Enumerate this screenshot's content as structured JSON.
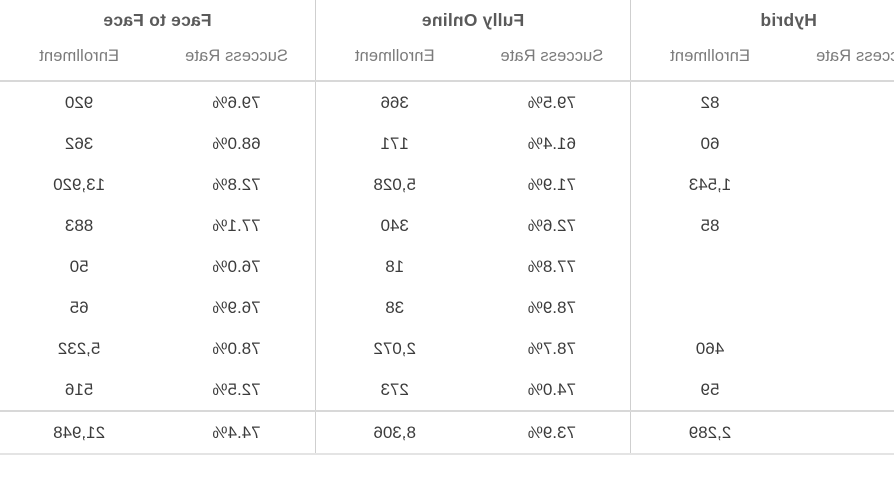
{
  "table": {
    "groups": [
      {
        "id": "hybrid",
        "label": "Hybrid"
      },
      {
        "id": "fully-online",
        "label": "Fully Online"
      },
      {
        "id": "face-to-face",
        "label": "Face to Face"
      }
    ],
    "subheaders": {
      "enrollment": "Enrollment",
      "success_rate": "Success Rate"
    },
    "columns": [
      "Hybrid Success Rate",
      "Hybrid Enrollment",
      "Fully Online Success Rate",
      "Fully Online Enrollment",
      "Face to Face Success Rate",
      "Face to Face Enrollment"
    ],
    "rows": [
      {
        "hybrid_success_rate": "",
        "hybrid_enrollment": "82",
        "online_success_rate": "79.5%",
        "online_enrollment": "366",
        "f2f_success_rate": "79.6%",
        "f2f_enrollment": "920",
        "is_total": false
      },
      {
        "hybrid_success_rate": "",
        "hybrid_enrollment": "60",
        "online_success_rate": "61.4%",
        "online_enrollment": "171",
        "f2f_success_rate": "68.0%",
        "f2f_enrollment": "362",
        "is_total": false
      },
      {
        "hybrid_success_rate": "",
        "hybrid_enrollment": "1,543",
        "online_success_rate": "71.9%",
        "online_enrollment": "5,028",
        "f2f_success_rate": "72.8%",
        "f2f_enrollment": "13,920",
        "is_total": false
      },
      {
        "hybrid_success_rate": "",
        "hybrid_enrollment": "85",
        "online_success_rate": "72.6%",
        "online_enrollment": "340",
        "f2f_success_rate": "77.1%",
        "f2f_enrollment": "883",
        "is_total": false
      },
      {
        "hybrid_success_rate": "",
        "hybrid_enrollment": "",
        "online_success_rate": "77.8%",
        "online_enrollment": "18",
        "f2f_success_rate": "76.0%",
        "f2f_enrollment": "50",
        "is_total": false
      },
      {
        "hybrid_success_rate": "",
        "hybrid_enrollment": "",
        "online_success_rate": "78.9%",
        "online_enrollment": "38",
        "f2f_success_rate": "76.9%",
        "f2f_enrollment": "65",
        "is_total": false
      },
      {
        "hybrid_success_rate": "",
        "hybrid_enrollment": "460",
        "online_success_rate": "78.7%",
        "online_enrollment": "2,072",
        "f2f_success_rate": "78.0%",
        "f2f_enrollment": "5,232",
        "is_total": false
      },
      {
        "hybrid_success_rate": "",
        "hybrid_enrollment": "59",
        "online_success_rate": "74.0%",
        "online_enrollment": "273",
        "f2f_success_rate": "72.5%",
        "f2f_enrollment": "516",
        "is_total": false
      },
      {
        "hybrid_success_rate": "",
        "hybrid_enrollment": "2,289",
        "online_success_rate": "73.9%",
        "online_enrollment": "8,306",
        "f2f_success_rate": "74.4%",
        "f2f_enrollment": "21,948",
        "is_total": true
      }
    ]
  },
  "style": {
    "header_text_color": "#5a5a5a",
    "subheader_text_color": "#7b7b7b",
    "body_text_color": "#3c3c3c",
    "rule_color": "#d8d8d8",
    "divider_color": "#cfcfcf",
    "background": "#ffffff"
  }
}
